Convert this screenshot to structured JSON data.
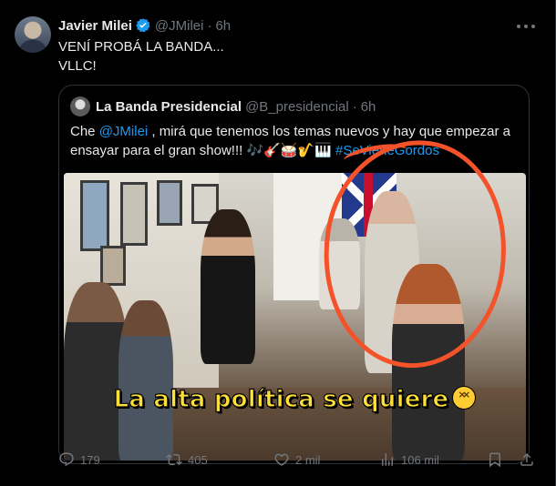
{
  "tweet": {
    "author_name": "Javier Milei",
    "handle": "@JMilei",
    "separator": "·",
    "time": "6h",
    "text_line1": "VENÍ PROBÁ LA BANDA...",
    "text_line2": "VLLC!"
  },
  "quote": {
    "author_name": "La Banda Presidencial",
    "handle": "@B_presidencial",
    "separator": "·",
    "time": "6h",
    "text_part1": "Che ",
    "mention": "@JMilei",
    "text_part2": " , mirá que tenemos los temas nuevos y hay que empezar a ensayar para el gran show!!! 🎶🎸🥁🎷🎹 ",
    "hashtag": "#SeVieneGordos",
    "video_caption": "La alta política se quiere"
  },
  "actions": {
    "replies": "179",
    "reposts": "405",
    "likes": "2 mil",
    "views": "106 mil"
  },
  "colors": {
    "background": "#000000",
    "accent": "#1d9bf0",
    "muted": "#71767b",
    "annotation": "#f4522b"
  },
  "icons": [
    "verified-badge-icon",
    "more-options-icon",
    "reply-icon",
    "repost-icon",
    "like-icon",
    "views-icon",
    "bookmark-icon",
    "share-icon"
  ]
}
